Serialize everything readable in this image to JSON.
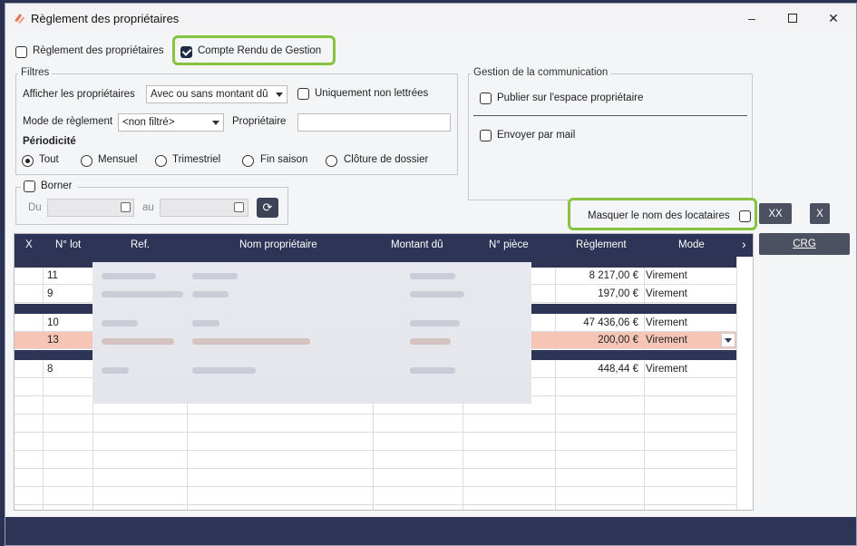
{
  "window": {
    "title": "Règlement des propriétaires",
    "controls": {
      "minimize": "–",
      "maximize": "☐",
      "close": "✕"
    }
  },
  "top_checks": {
    "reglement_label": "Règlement des propriétaires",
    "crg_label": "Compte Rendu de Gestion"
  },
  "filtres": {
    "title": "Filtres",
    "afficher_label": "Afficher les propriétaires",
    "afficher_value": "Avec ou sans montant dû",
    "non_lettrees_label": "Uniquement non lettrées",
    "mode_label": "Mode de règlement",
    "mode_value": "<non filtré>",
    "proprietaire_label": "Propriétaire",
    "proprietaire_value": "",
    "periodicite_label": "Périodicité",
    "periodicite_options": [
      "Tout",
      "Mensuel",
      "Trimestriel",
      "Fin saison",
      "Clôture de dossier"
    ]
  },
  "borner": {
    "label": "Borner",
    "du_label": "Du",
    "au_label": "au",
    "refresh_icon": "refresh-icon"
  },
  "communication": {
    "title": "Gestion de la communication",
    "publier_label": "Publier sur l'espace propriétaire",
    "mail_label": "Envoyer par mail"
  },
  "masquer": {
    "label": "Masquer le nom des locataires"
  },
  "buttons": {
    "xx": "XX",
    "x": "X",
    "crg": "CRG"
  },
  "grid": {
    "columns": [
      "X",
      "N° lot",
      "Ref.",
      "Nom propriétaire",
      "Montant dû",
      "N° pièce",
      "Règlement",
      "Mode"
    ],
    "scroll_arrow": "›",
    "rows": [
      {
        "lot": "11",
        "reglement": "8 217,00 €",
        "mode": "Virement"
      },
      {
        "lot": "9",
        "reglement": "197,00 €",
        "mode": "Virement"
      },
      {
        "lot": "10",
        "reglement": "47 436,06 €",
        "mode": "Virement"
      },
      {
        "lot": "13",
        "reglement": "200,00 €",
        "mode": "Virement"
      },
      {
        "lot": "8",
        "reglement": "448,44 €",
        "mode": "Virement"
      }
    ]
  },
  "colors": {
    "accent": "#2d3456",
    "highlight": "#86c440",
    "selected_row": "#f6c5b6"
  }
}
